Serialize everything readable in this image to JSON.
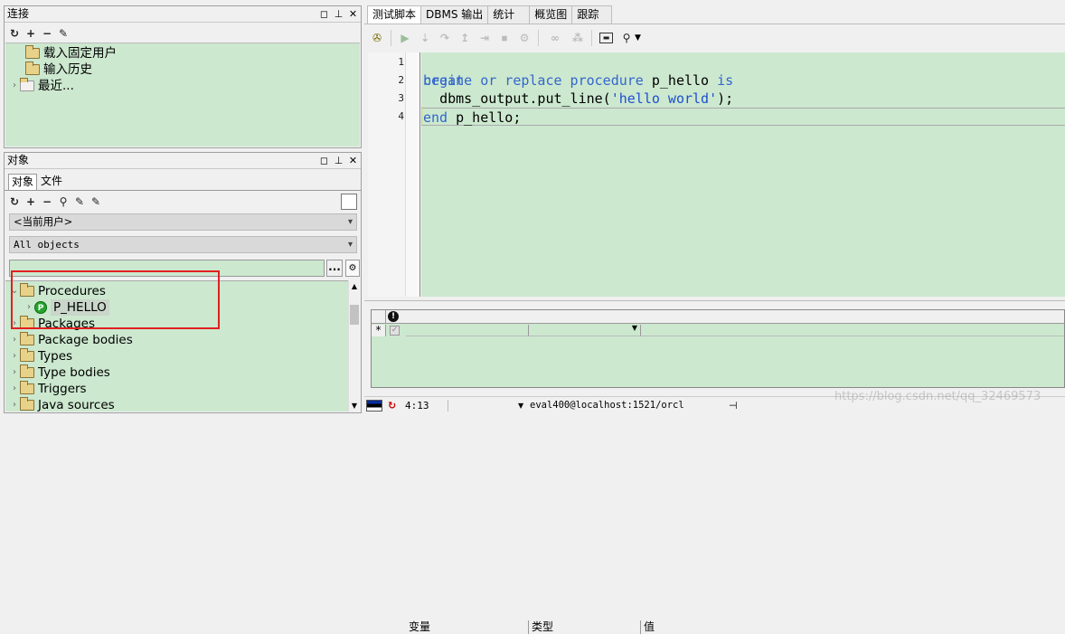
{
  "connections_panel": {
    "title": "连接",
    "items": [
      "载入固定用户",
      "输入历史",
      "最近..."
    ]
  },
  "objects_panel": {
    "title": "对象",
    "tabs": [
      "对象",
      "文件"
    ],
    "owner_select": "<当前用户>",
    "type_select": "All objects",
    "filter_button": "...",
    "tree": [
      {
        "label": "Procedures",
        "expanded": true
      },
      {
        "label": "P_HELLO",
        "child": true
      },
      {
        "label": "Packages"
      },
      {
        "label": "Package bodies"
      },
      {
        "label": "Types"
      },
      {
        "label": "Type bodies"
      },
      {
        "label": "Triggers"
      },
      {
        "label": "Java sources"
      }
    ]
  },
  "editor": {
    "tabs": [
      "测试脚本",
      "DBMS 输出",
      "统计",
      "概览图",
      "跟踪"
    ],
    "line_numbers": [
      "1",
      "2",
      "3",
      "4"
    ],
    "line1": {
      "kw1": "create or replace procedure",
      "name": "p_hello",
      "kw2": "is"
    },
    "line2": "begin",
    "line3": {
      "call": "dbms_output.put_line(",
      "str": "'hello world'",
      "end": ");"
    },
    "line4": {
      "kw": "end",
      "rest": "p_hello;"
    }
  },
  "variables_grid": {
    "columns": [
      "变量",
      "类型",
      "值"
    ],
    "new_row_marker": "*"
  },
  "status_bar": {
    "position": "4:13",
    "connection": "eval400@localhost:1521/orcl",
    "watermark": "https://blog.csdn.net/qq_32469573"
  },
  "colors": {
    "editor_bg": "#cce8cf",
    "keyword": "#3366cc",
    "highlight_box": "#e02020"
  }
}
